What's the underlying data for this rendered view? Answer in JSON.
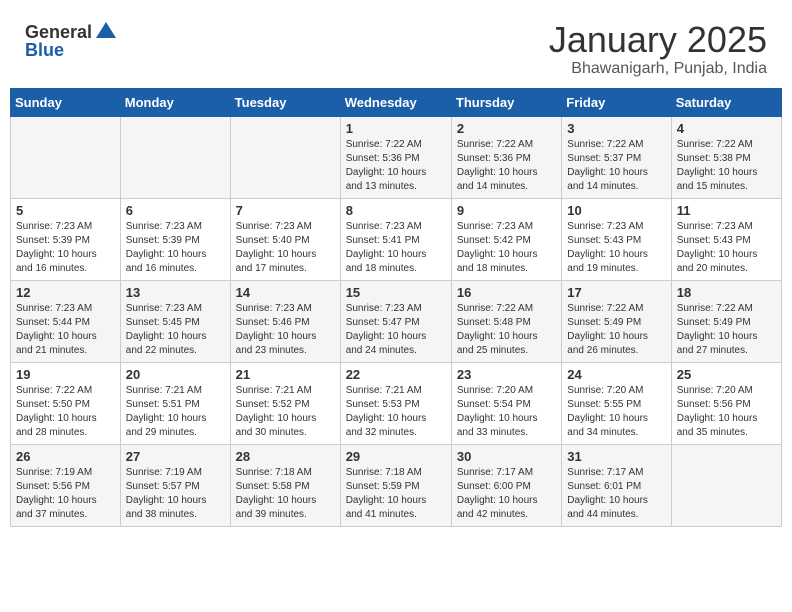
{
  "header": {
    "logo_line1": "General",
    "logo_line2": "Blue",
    "month": "January 2025",
    "location": "Bhawanigarh, Punjab, India"
  },
  "weekdays": [
    "Sunday",
    "Monday",
    "Tuesday",
    "Wednesday",
    "Thursday",
    "Friday",
    "Saturday"
  ],
  "weeks": [
    [
      {
        "day": "",
        "info": ""
      },
      {
        "day": "",
        "info": ""
      },
      {
        "day": "",
        "info": ""
      },
      {
        "day": "1",
        "info": "Sunrise: 7:22 AM\nSunset: 5:36 PM\nDaylight: 10 hours\nand 13 minutes."
      },
      {
        "day": "2",
        "info": "Sunrise: 7:22 AM\nSunset: 5:36 PM\nDaylight: 10 hours\nand 14 minutes."
      },
      {
        "day": "3",
        "info": "Sunrise: 7:22 AM\nSunset: 5:37 PM\nDaylight: 10 hours\nand 14 minutes."
      },
      {
        "day": "4",
        "info": "Sunrise: 7:22 AM\nSunset: 5:38 PM\nDaylight: 10 hours\nand 15 minutes."
      }
    ],
    [
      {
        "day": "5",
        "info": "Sunrise: 7:23 AM\nSunset: 5:39 PM\nDaylight: 10 hours\nand 16 minutes."
      },
      {
        "day": "6",
        "info": "Sunrise: 7:23 AM\nSunset: 5:39 PM\nDaylight: 10 hours\nand 16 minutes."
      },
      {
        "day": "7",
        "info": "Sunrise: 7:23 AM\nSunset: 5:40 PM\nDaylight: 10 hours\nand 17 minutes."
      },
      {
        "day": "8",
        "info": "Sunrise: 7:23 AM\nSunset: 5:41 PM\nDaylight: 10 hours\nand 18 minutes."
      },
      {
        "day": "9",
        "info": "Sunrise: 7:23 AM\nSunset: 5:42 PM\nDaylight: 10 hours\nand 18 minutes."
      },
      {
        "day": "10",
        "info": "Sunrise: 7:23 AM\nSunset: 5:43 PM\nDaylight: 10 hours\nand 19 minutes."
      },
      {
        "day": "11",
        "info": "Sunrise: 7:23 AM\nSunset: 5:43 PM\nDaylight: 10 hours\nand 20 minutes."
      }
    ],
    [
      {
        "day": "12",
        "info": "Sunrise: 7:23 AM\nSunset: 5:44 PM\nDaylight: 10 hours\nand 21 minutes."
      },
      {
        "day": "13",
        "info": "Sunrise: 7:23 AM\nSunset: 5:45 PM\nDaylight: 10 hours\nand 22 minutes."
      },
      {
        "day": "14",
        "info": "Sunrise: 7:23 AM\nSunset: 5:46 PM\nDaylight: 10 hours\nand 23 minutes."
      },
      {
        "day": "15",
        "info": "Sunrise: 7:23 AM\nSunset: 5:47 PM\nDaylight: 10 hours\nand 24 minutes."
      },
      {
        "day": "16",
        "info": "Sunrise: 7:22 AM\nSunset: 5:48 PM\nDaylight: 10 hours\nand 25 minutes."
      },
      {
        "day": "17",
        "info": "Sunrise: 7:22 AM\nSunset: 5:49 PM\nDaylight: 10 hours\nand 26 minutes."
      },
      {
        "day": "18",
        "info": "Sunrise: 7:22 AM\nSunset: 5:49 PM\nDaylight: 10 hours\nand 27 minutes."
      }
    ],
    [
      {
        "day": "19",
        "info": "Sunrise: 7:22 AM\nSunset: 5:50 PM\nDaylight: 10 hours\nand 28 minutes."
      },
      {
        "day": "20",
        "info": "Sunrise: 7:21 AM\nSunset: 5:51 PM\nDaylight: 10 hours\nand 29 minutes."
      },
      {
        "day": "21",
        "info": "Sunrise: 7:21 AM\nSunset: 5:52 PM\nDaylight: 10 hours\nand 30 minutes."
      },
      {
        "day": "22",
        "info": "Sunrise: 7:21 AM\nSunset: 5:53 PM\nDaylight: 10 hours\nand 32 minutes."
      },
      {
        "day": "23",
        "info": "Sunrise: 7:20 AM\nSunset: 5:54 PM\nDaylight: 10 hours\nand 33 minutes."
      },
      {
        "day": "24",
        "info": "Sunrise: 7:20 AM\nSunset: 5:55 PM\nDaylight: 10 hours\nand 34 minutes."
      },
      {
        "day": "25",
        "info": "Sunrise: 7:20 AM\nSunset: 5:56 PM\nDaylight: 10 hours\nand 35 minutes."
      }
    ],
    [
      {
        "day": "26",
        "info": "Sunrise: 7:19 AM\nSunset: 5:56 PM\nDaylight: 10 hours\nand 37 minutes."
      },
      {
        "day": "27",
        "info": "Sunrise: 7:19 AM\nSunset: 5:57 PM\nDaylight: 10 hours\nand 38 minutes."
      },
      {
        "day": "28",
        "info": "Sunrise: 7:18 AM\nSunset: 5:58 PM\nDaylight: 10 hours\nand 39 minutes."
      },
      {
        "day": "29",
        "info": "Sunrise: 7:18 AM\nSunset: 5:59 PM\nDaylight: 10 hours\nand 41 minutes."
      },
      {
        "day": "30",
        "info": "Sunrise: 7:17 AM\nSunset: 6:00 PM\nDaylight: 10 hours\nand 42 minutes."
      },
      {
        "day": "31",
        "info": "Sunrise: 7:17 AM\nSunset: 6:01 PM\nDaylight: 10 hours\nand 44 minutes."
      },
      {
        "day": "",
        "info": ""
      }
    ]
  ]
}
